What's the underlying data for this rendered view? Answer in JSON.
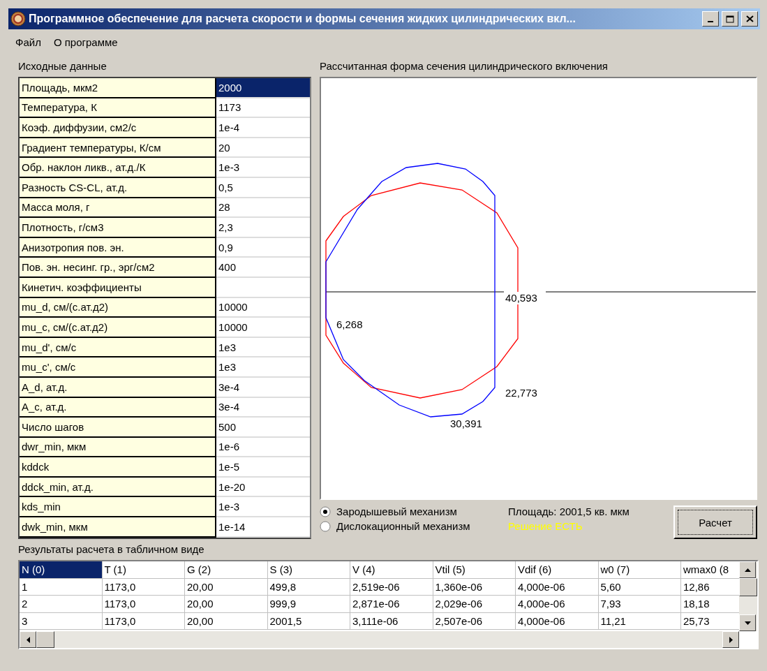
{
  "window": {
    "title": "Программное обеспечение для расчета скорости и формы сечения жидких цилиндрических вкл..."
  },
  "menu": [
    {
      "label": "Файл"
    },
    {
      "label": "О программе"
    }
  ],
  "input": {
    "title": "Исходные данные",
    "rows": [
      {
        "label": "Площадь, мкм2",
        "value": "2000",
        "selected": true
      },
      {
        "label": "Температура, К",
        "value": "1173",
        "selected": false
      },
      {
        "label": "Коэф. диффузии, см2/с",
        "value": "1e-4",
        "selected": false
      },
      {
        "label": "Градиент температуры, К/см",
        "value": "20",
        "selected": false
      },
      {
        "label": "Обр. наклон ликв., ат.д./К",
        "value": "1e-3",
        "selected": false
      },
      {
        "label": "Разность CS-CL, ат.д.",
        "value": "0,5",
        "selected": false
      },
      {
        "label": "Масса моля, г",
        "value": "28",
        "selected": false
      },
      {
        "label": "Плотность, г/см3",
        "value": "2,3",
        "selected": false
      },
      {
        "label": "Анизотропия пов. эн.",
        "value": "0,9",
        "selected": false
      },
      {
        "label": "Пов. эн. несинг. гр., эрг/см2",
        "value": "400",
        "selected": false
      },
      {
        "label": "Кинетич. коэффициенты",
        "selected": false
      },
      {
        "label": "mu_d, см/(с.ат.д2)",
        "value": "10000",
        "selected": false
      },
      {
        "label": "mu_c, см/(с.ат.д2)",
        "value": "10000",
        "selected": false
      },
      {
        "label": "mu_d', см/с",
        "value": "1e3",
        "selected": false
      },
      {
        "label": "mu_c', см/с",
        "value": "1e3",
        "selected": false
      },
      {
        "label": "A_d, ат.д.",
        "value": "3e-4",
        "selected": false
      },
      {
        "label": "A_c, ат.д.",
        "value": "3e-4",
        "selected": false
      },
      {
        "label": "Число шагов",
        "value": "500",
        "selected": false
      },
      {
        "label": "dwr_min, мкм",
        "value": "1e-6",
        "selected": false
      },
      {
        "label": "kddck",
        "value": "1e-5",
        "selected": false
      },
      {
        "label": "ddck_min, ат.д.",
        "value": "1e-20",
        "selected": false
      },
      {
        "label": "kds_min",
        "value": "1e-3",
        "selected": false
      },
      {
        "label": "dwk_min, мкм",
        "value": "1e-14",
        "selected": false
      }
    ]
  },
  "plot": {
    "title": "Рассчитанная форма сечения цилиндрического включения",
    "labels": [
      {
        "text": "40,593"
      },
      {
        "text": "6,268"
      },
      {
        "text": "22,773"
      },
      {
        "text": "30,391"
      }
    ]
  },
  "mechanisms": [
    {
      "label": "Зародышевый механизм",
      "selected": true
    },
    {
      "label": "Дислокационный механизм",
      "selected": false
    }
  ],
  "area_text": "Площадь: 2001,5 кв. мкм",
  "status_text": "Решение ЕСТЬ",
  "calc_button": "Расчет",
  "results": {
    "title": "Результаты расчета в табличном виде",
    "columns": [
      {
        "label": "N (0)",
        "selected": true
      },
      {
        "label": "T (1)",
        "selected": false
      },
      {
        "label": "G (2)",
        "selected": false
      },
      {
        "label": "S (3)",
        "selected": false
      },
      {
        "label": "V (4)",
        "selected": false
      },
      {
        "label": "Vtil (5)",
        "selected": false
      },
      {
        "label": "Vdif (6)",
        "selected": false
      },
      {
        "label": "w0 (7)",
        "selected": false
      },
      {
        "label": "wmax0 (8",
        "selected": false
      }
    ],
    "rows": [
      [
        "1",
        "1173,0",
        "20,00",
        "499,8",
        "2,519e-06",
        "1,360e-06",
        "4,000e-06",
        "5,60",
        "12,86"
      ],
      [
        "2",
        "1173,0",
        "20,00",
        "999,9",
        "2,871e-06",
        "2,029e-06",
        "4,000e-06",
        "7,93",
        "18,18"
      ],
      [
        "3",
        "1173,0",
        "20,00",
        "2001,5",
        "3,111e-06",
        "2,507e-06",
        "4,000e-06",
        "11,21",
        "25,73"
      ]
    ]
  }
}
